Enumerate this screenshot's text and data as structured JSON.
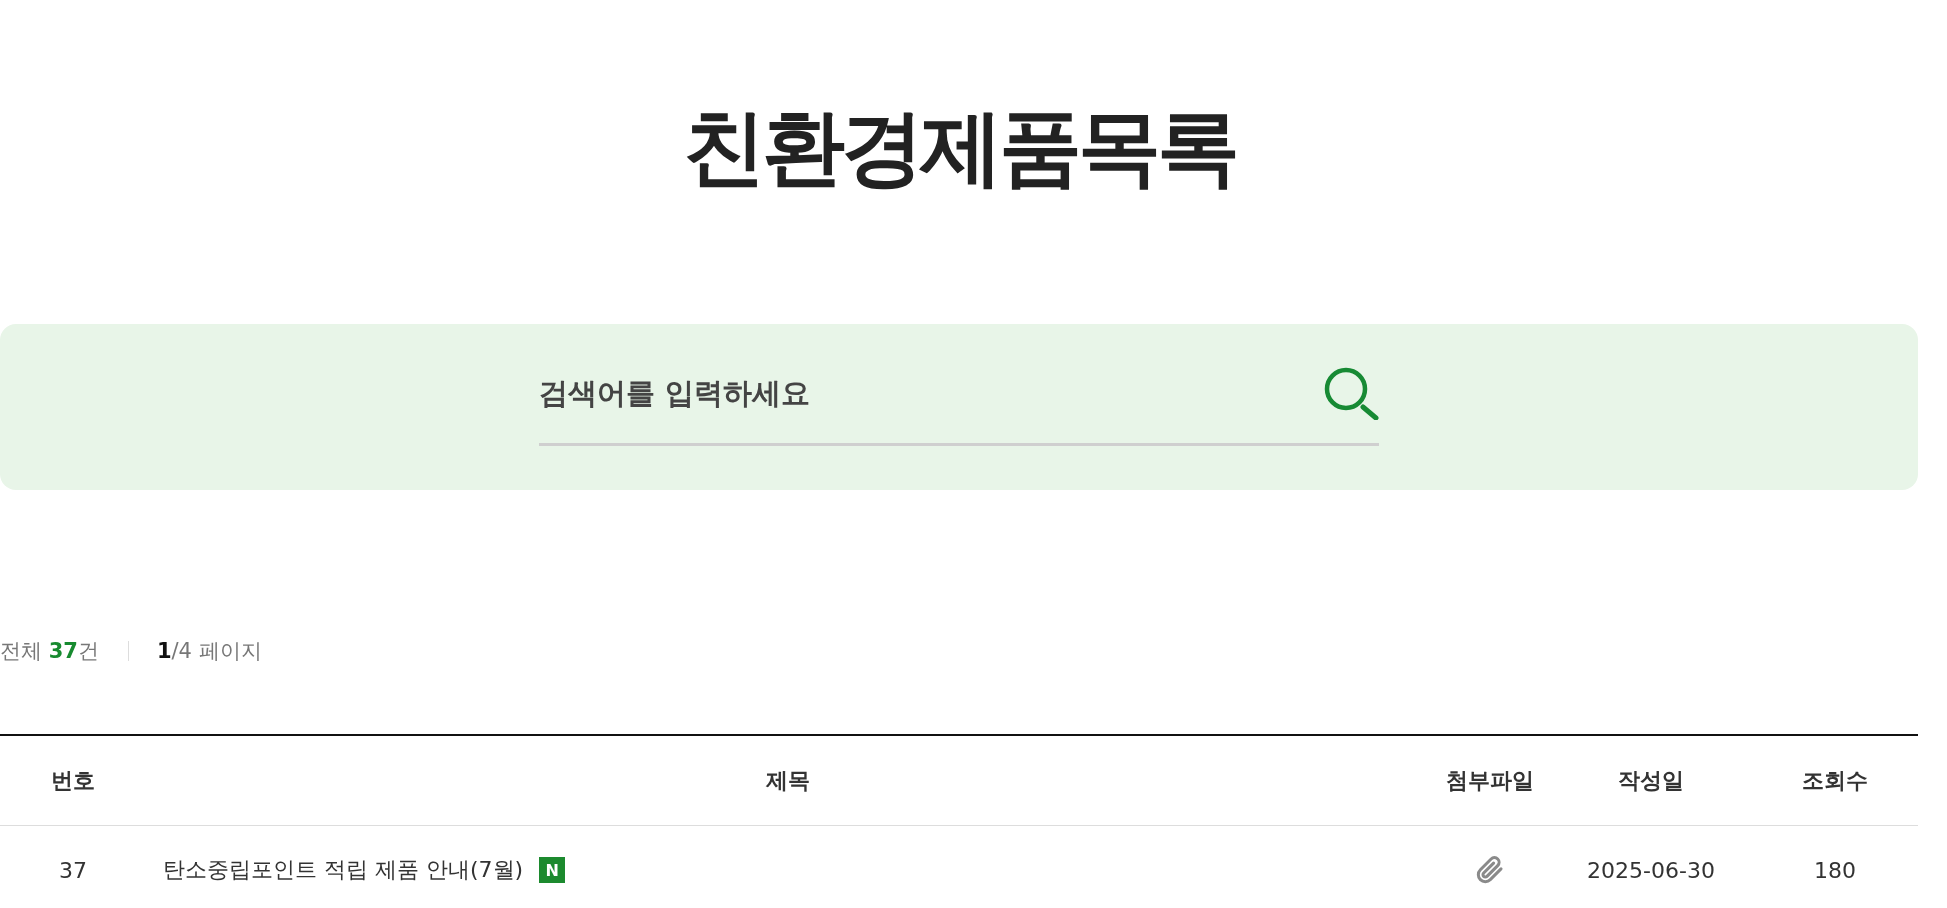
{
  "page_title": "친환경제품목록",
  "search": {
    "placeholder": "검색어를 입력하세요"
  },
  "summary": {
    "total": "전체 **37**건",
    "pages": "**1**/4 페이지"
  },
  "table": {
    "columns": [
      "번호",
      "제목",
      "첨부파일",
      "작성일",
      "조회수"
    ],
    "rows": [
      {
        "number": "37",
        "title": "탄소중립포인트 적립 제품 안내(7월)",
        "badge": "N",
        "attachment": true,
        "date": "2025-06-30",
        "views": "180"
      }
    ]
  }
}
